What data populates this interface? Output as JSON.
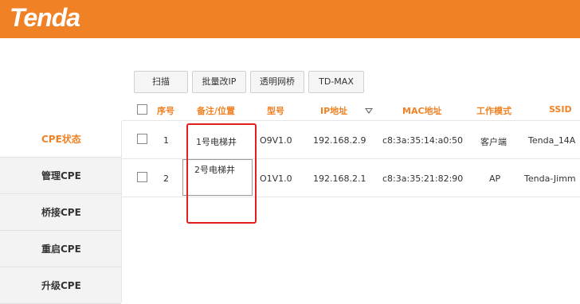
{
  "brand": {
    "logo_text": "Tenda",
    "header_color": "#f08225",
    "accent_color": "#f08225"
  },
  "toolbar": {
    "scan": "扫描",
    "batch_ip": "批量改IP",
    "transparent_bridge": "透明网桥",
    "td_max": "TD-MAX"
  },
  "sidebar": {
    "items": [
      {
        "label": "CPE状态",
        "active": true
      },
      {
        "label": "管理CPE"
      },
      {
        "label": "桥接CPE"
      },
      {
        "label": "重启CPE"
      },
      {
        "label": "升级CPE"
      }
    ]
  },
  "table": {
    "headers": {
      "index": "序号",
      "note": "备注/位置",
      "model": "型号",
      "ip": "IP地址",
      "mac": "MAC地址",
      "mode": "工作模式",
      "ssid": "SSID"
    },
    "rows": [
      {
        "index": "1",
        "note": "1号电梯井",
        "model": "O9V1.0",
        "ip": "192.168.2.9",
        "mac": "c8:3a:35:14:a0:50",
        "mode": "客户端",
        "ssid": "Tenda_14A"
      },
      {
        "index": "2",
        "note": "2号电梯井",
        "model": "O1V1.0",
        "ip": "192.168.2.1",
        "mac": "c8:3a:35:21:82:90",
        "mode": "AP",
        "ssid": "Tenda-Jimm"
      }
    ]
  },
  "icons": {
    "sort": "sort-down-icon"
  },
  "highlight_color": "#e02020"
}
